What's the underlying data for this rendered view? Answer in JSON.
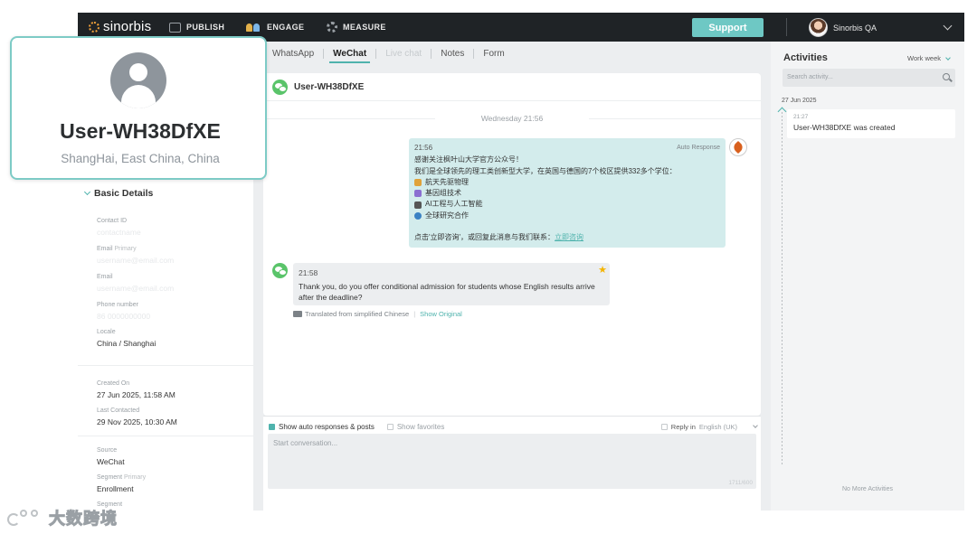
{
  "topbar": {
    "brand": "sinorbis",
    "nav": [
      {
        "label": "PUBLISH",
        "icon": "publish-icon"
      },
      {
        "label": "ENGAGE",
        "icon": "engage-people-icon"
      },
      {
        "label": "MEASURE",
        "icon": "gear-icon"
      }
    ],
    "support_label": "Support",
    "user_name": "Sinorbis QA"
  },
  "contact_card": {
    "name": "User-WH38DfXE",
    "location": "ShangHai, East China, China"
  },
  "details": {
    "section_title": "Basic Details",
    "contact_id_label": "Contact ID",
    "contact_id_value": "contactname",
    "email_primary_label": "Email",
    "email_primary_sub": "Primary",
    "email_primary_value": "username@email.com",
    "email_label": "Email",
    "email_value": "username@email.com",
    "phone_label": "Phone number",
    "phone_value": "86 0000000000",
    "locale_label": "Locale",
    "locale_value": "China / Shanghai",
    "created_label": "Created On",
    "created_value": "27 Jun 2025, 11:58 AM",
    "last_contacted_label": "Last Contacted",
    "last_contacted_value": "29 Nov 2025, 10:30 AM",
    "source_label": "Source",
    "source_value": "WeChat",
    "segment_label": "Segment",
    "segment_sub": "Primary",
    "segment_value": "Enrollment",
    "segment2_label": "Segment"
  },
  "tabs": [
    {
      "label": "WhatsApp",
      "state": "normal"
    },
    {
      "label": "WeChat",
      "state": "active"
    },
    {
      "label": "Live chat",
      "state": "disabled"
    },
    {
      "label": "Notes",
      "state": "normal"
    },
    {
      "label": "Form",
      "state": "normal"
    }
  ],
  "chat": {
    "header_name": "User-WH38DfXE",
    "date_divider": "Wednesday 21:56",
    "outgoing": {
      "time": "21:56",
      "tag": "Auto Response",
      "line1": "感谢关注枫叶山大学官方公众号！",
      "line2": "我们是全球领先的理工类创新型大学，在英国与德国的7个校区提供332多个学位：",
      "items": [
        {
          "text": "航天先驱物理",
          "color": "#e0a23a"
        },
        {
          "text": "基因组技术",
          "color": "#8a6fd1"
        },
        {
          "text": "AI工程与人工智能",
          "color": "#555555"
        },
        {
          "text": "全球研究合作",
          "color": "#3b82c4"
        }
      ],
      "cta_text": "点击'立即咨询'，或回复此消息与我们联系：",
      "cta_link": "立即咨询"
    },
    "incoming": {
      "time": "21:58",
      "text": "Thank you, do you offer conditional admission for students whose English results arrive after the deadline?",
      "translated_label": "Translated from simplified Chinese",
      "show_original": "Show Original"
    }
  },
  "composer": {
    "show_auto_label": "Show auto responses & posts",
    "show_fav_label": "Show favorites",
    "reply_in_label": "Reply in",
    "reply_lang": "English (UK)",
    "placeholder": "Start conversation...",
    "char_count": "1711/600"
  },
  "activities": {
    "title": "Activities",
    "filter": "Work week",
    "search_placeholder": "Search activity...",
    "date": "27 Jun 2025",
    "items": [
      {
        "time": "21:27",
        "text": "User-WH38DfXE was created"
      }
    ],
    "no_more": "No More Activities"
  },
  "watermark": {
    "text": "大数跨境"
  },
  "colors": {
    "accent": "#4fb3ad",
    "topbar": "#1f2326",
    "support": "#6ec8c4",
    "bubble_out": "#d3ecec",
    "bubble_in": "#eceef0"
  }
}
